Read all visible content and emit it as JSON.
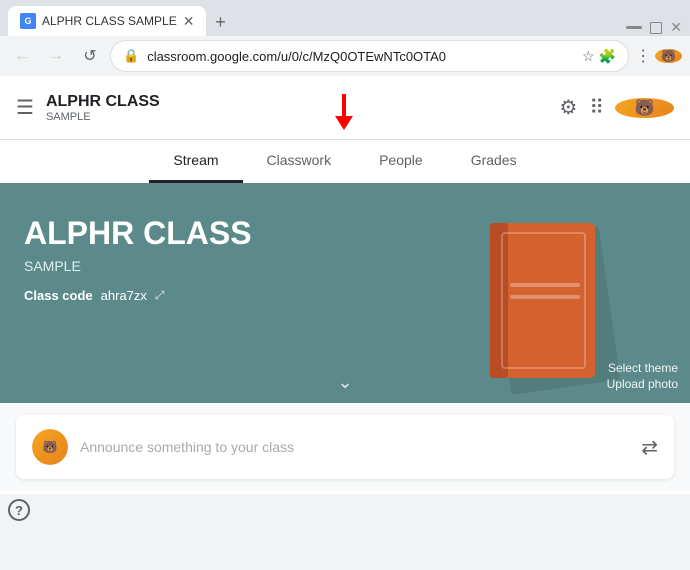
{
  "browser": {
    "tab_title": "ALPHR CLASS SAMPLE",
    "address": "classroom.google.com/u/0/c/MzQ0OTEwNTc0OTA0",
    "new_tab_symbol": "+",
    "back_symbol": "←",
    "forward_symbol": "→",
    "refresh_symbol": "↺"
  },
  "app": {
    "brand_title": "ALPHR CLASS",
    "brand_subtitle": "SAMPLE",
    "tabs": [
      {
        "label": "Stream",
        "active": true
      },
      {
        "label": "Classwork",
        "active": false
      },
      {
        "label": "People",
        "active": false
      },
      {
        "label": "Grades",
        "active": false
      }
    ],
    "banner": {
      "class_name": "ALPHR CLASS",
      "subtitle": "SAMPLE",
      "class_code_label": "Class code",
      "class_code_value": "ahra7zx",
      "chevron": "⌄",
      "select_theme": "Select theme",
      "upload_photo": "Upload photo"
    },
    "announce": {
      "placeholder": "Announce something to your class"
    },
    "footer": {
      "help": "?"
    }
  }
}
